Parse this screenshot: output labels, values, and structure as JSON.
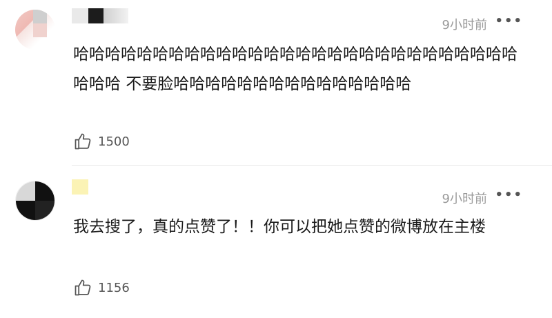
{
  "comments": [
    {
      "username": "",
      "time": "9小时前",
      "more": "•••",
      "text": "哈哈哈哈哈哈哈哈哈哈哈哈哈哈哈哈哈哈哈哈哈哈哈哈哈哈哈哈哈哈哈 不要脸哈哈哈哈哈哈哈哈哈哈哈哈哈哈哈",
      "likes": "1500"
    },
    {
      "username": "",
      "time": "9小时前",
      "more": "•••",
      "text": "我去搜了，真的点赞了！！你可以把她点赞的微博放在主楼",
      "likes": "1156"
    }
  ],
  "icons": {
    "like": "thumbs-up-icon",
    "more": "more-icon"
  }
}
